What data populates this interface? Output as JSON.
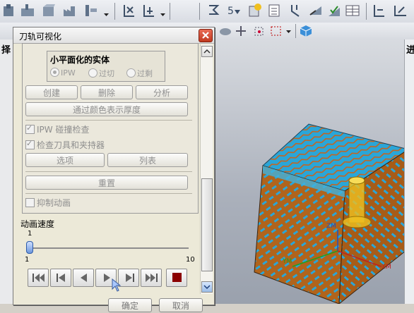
{
  "left_edge_label": "择",
  "right_edge_label": "进",
  "dialog": {
    "title": "刀轨可视化",
    "group_title": "小平面化的实体",
    "radio_options": [
      "IPW",
      "过切",
      "过剩"
    ],
    "buttons_row1": [
      "创建",
      "删除",
      "分析"
    ],
    "color_thickness_button": "通过颜色表示厚度",
    "check_ipw": "IPW 碰撞检查",
    "check_tool_holder": "检查刀具和夹持器",
    "options_button": "选项",
    "list_button": "列表",
    "reset_button": "重置",
    "suppress_animation": "抑制动画",
    "animation_speed_label": "动画速度",
    "speed_current": "1",
    "speed_min": "1",
    "speed_max": "10",
    "speed_value": 1,
    "ok_button": "确定",
    "cancel_button": "取消"
  },
  "viewport": {
    "axis_labels": [
      "ZM",
      "YM",
      "XM"
    ]
  },
  "colors": {
    "cube_top": "#2aa6d8",
    "cube_side": "#b0641c",
    "tool": "#f0c020",
    "stop_button": "#8b0000"
  }
}
